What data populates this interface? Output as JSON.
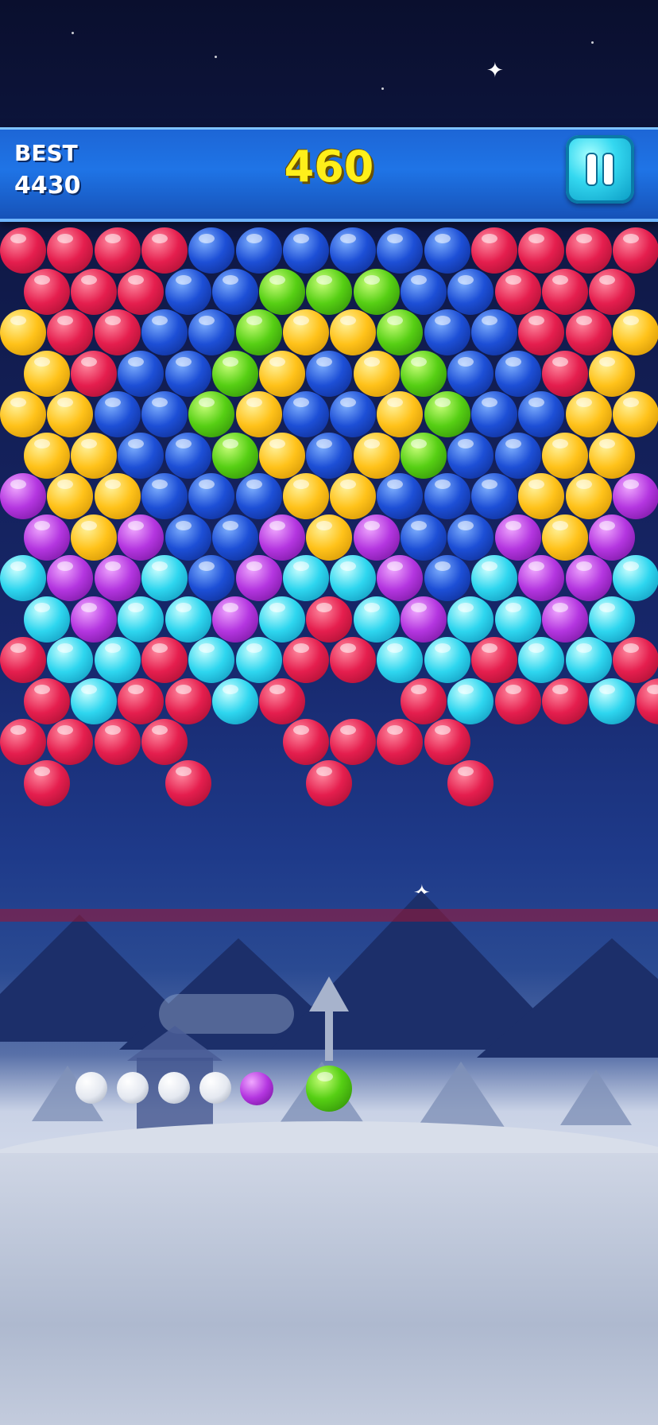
{
  "hud": {
    "best_label": "BEST",
    "best_value": "4430",
    "score": "460",
    "pause_icon": "pause-icon"
  },
  "colors": {
    "R": [
      "#ff8aa0",
      "#e51e4e",
      "#9c0d2d"
    ],
    "B": [
      "#7fb0ff",
      "#1d4fd6",
      "#0b2787"
    ],
    "G": [
      "#c9ff7a",
      "#56cf14",
      "#2a8406"
    ],
    "Y": [
      "#fff29a",
      "#ffc21a",
      "#c98b00"
    ],
    "P": [
      "#f0a8ff",
      "#b436e0",
      "#6d0f93"
    ],
    "C": [
      "#cbffff",
      "#2ed6ef",
      "#0b8cb3"
    ]
  },
  "bubble_grid": [
    "RRRRBBBBBBRRRR",
    "RRRBBGGGBBRRR",
    "YRRBBGYYGBBRRY",
    "YRBBGYBYGBBRY",
    "YYBBGYBBYGBBYY",
    "YYBBGYBYGBBYY",
    "PYYBBBYYBBBYYP",
    "PYPBBPYPBBPYP",
    "CPPCBPCCPBCPPC",
    "CPCCPCRCPCCPC",
    "RCCRCCRRCCRCCR",
    "RCRRCR..RCRRCR",
    "RRRR..RRRR",
    "R..R..R..R"
  ],
  "shooter": {
    "current_color": "G",
    "next_color": "P",
    "remaining_shots": 4
  }
}
